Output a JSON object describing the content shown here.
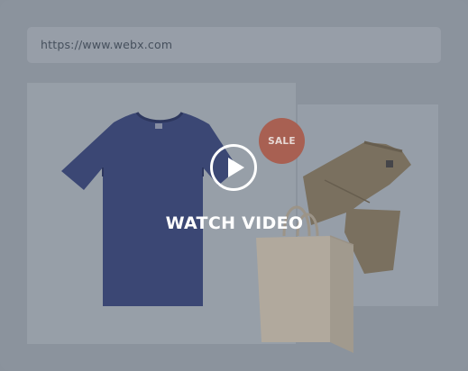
{
  "browser": {
    "url": "https://www.webx.com"
  },
  "promo": {
    "sale_label": "SALE"
  },
  "video": {
    "watch_label": "WATCH VIDEO"
  },
  "colors": {
    "overlay": "#8b939d",
    "sale_badge": "#a86052",
    "tshirt": "#3b4774",
    "pants": "#7a705f",
    "bag": "#b1a99d"
  },
  "icons": [
    "play-icon",
    "tshirt-image",
    "pants-image",
    "shopping-bag-image"
  ]
}
